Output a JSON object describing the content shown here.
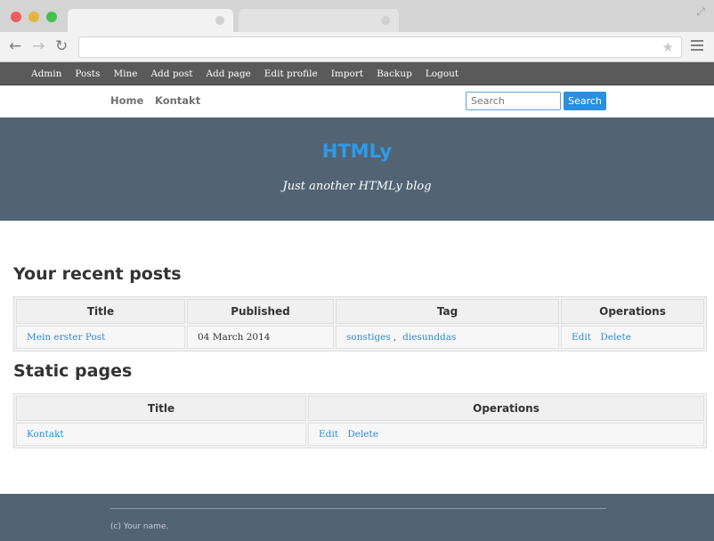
{
  "admin_bar": {
    "items": [
      "Admin",
      "Posts",
      "Mine",
      "Add post",
      "Add page",
      "Edit profile",
      "Import",
      "Backup",
      "Logout"
    ]
  },
  "nav": {
    "home": "Home",
    "kontakt": "Kontakt"
  },
  "search": {
    "placeholder": "Search",
    "button": "Search"
  },
  "hero": {
    "title": "HTMLy",
    "subtitle": "Just another HTMLy blog"
  },
  "recent_posts": {
    "heading": "Your recent posts",
    "columns": [
      "Title",
      "Published",
      "Tag",
      "Operations"
    ],
    "rows": [
      {
        "title": "Mein erster Post",
        "published": "04 March 2014",
        "tag1": "sonstiges",
        "tag_sep": ",",
        "tag2": "diesunddas",
        "edit": "Edit",
        "delete": "Delete"
      }
    ]
  },
  "static_pages": {
    "heading": "Static pages",
    "columns": [
      "Title",
      "Operations"
    ],
    "rows": [
      {
        "title": "Kontakt",
        "edit": "Edit",
        "delete": "Delete"
      }
    ]
  },
  "footer": {
    "text": "(c) Your name."
  },
  "colors": {
    "hero_bg": "#526374",
    "accent": "#2d9be8",
    "link": "#2d8ad6",
    "admin_bar_bg": "#5a5a5a"
  }
}
